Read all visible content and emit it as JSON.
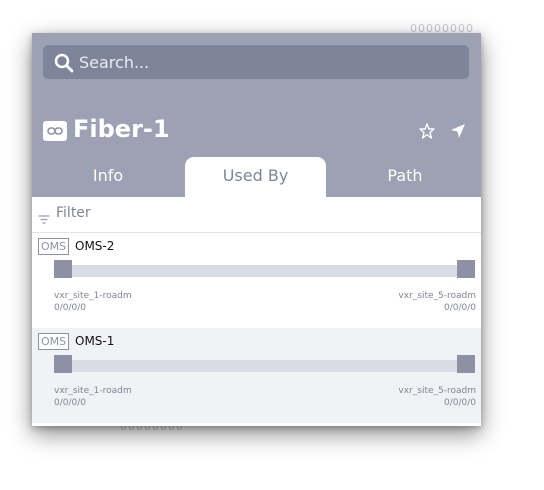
{
  "background": {
    "top_ghost_text": "00000000",
    "bottom_ghost_text": "00000000"
  },
  "search": {
    "placeholder": "Search...",
    "value": "",
    "icon": "search-icon"
  },
  "header": {
    "title": "Fiber-1",
    "type_icon": "link-icon",
    "actions": [
      "star-icon",
      "navigate-icon"
    ]
  },
  "tabs": [
    {
      "label": "Info",
      "active": false
    },
    {
      "label": "Used By",
      "active": true
    },
    {
      "label": "Path",
      "active": false
    }
  ],
  "filter": {
    "label": "Filter",
    "icon": "filter-icon"
  },
  "items": [
    {
      "type": "OMS",
      "name": "OMS-2",
      "left": {
        "site": "vxr_site_1-roadm",
        "port": "0/0/0/0"
      },
      "right": {
        "site": "vxr_site_5-roadm",
        "port": "0/0/0/0"
      }
    },
    {
      "type": "OMS",
      "name": "OMS-1",
      "left": {
        "site": "vxr_site_1-roadm",
        "port": "0/0/0/0"
      },
      "right": {
        "site": "vxr_site_5-roadm",
        "port": "0/0/0/0"
      }
    }
  ],
  "colors": {
    "header": "#9ca1b3",
    "search": "#7e8499",
    "accent": "#8c91a6",
    "track": "#d9dce4"
  }
}
